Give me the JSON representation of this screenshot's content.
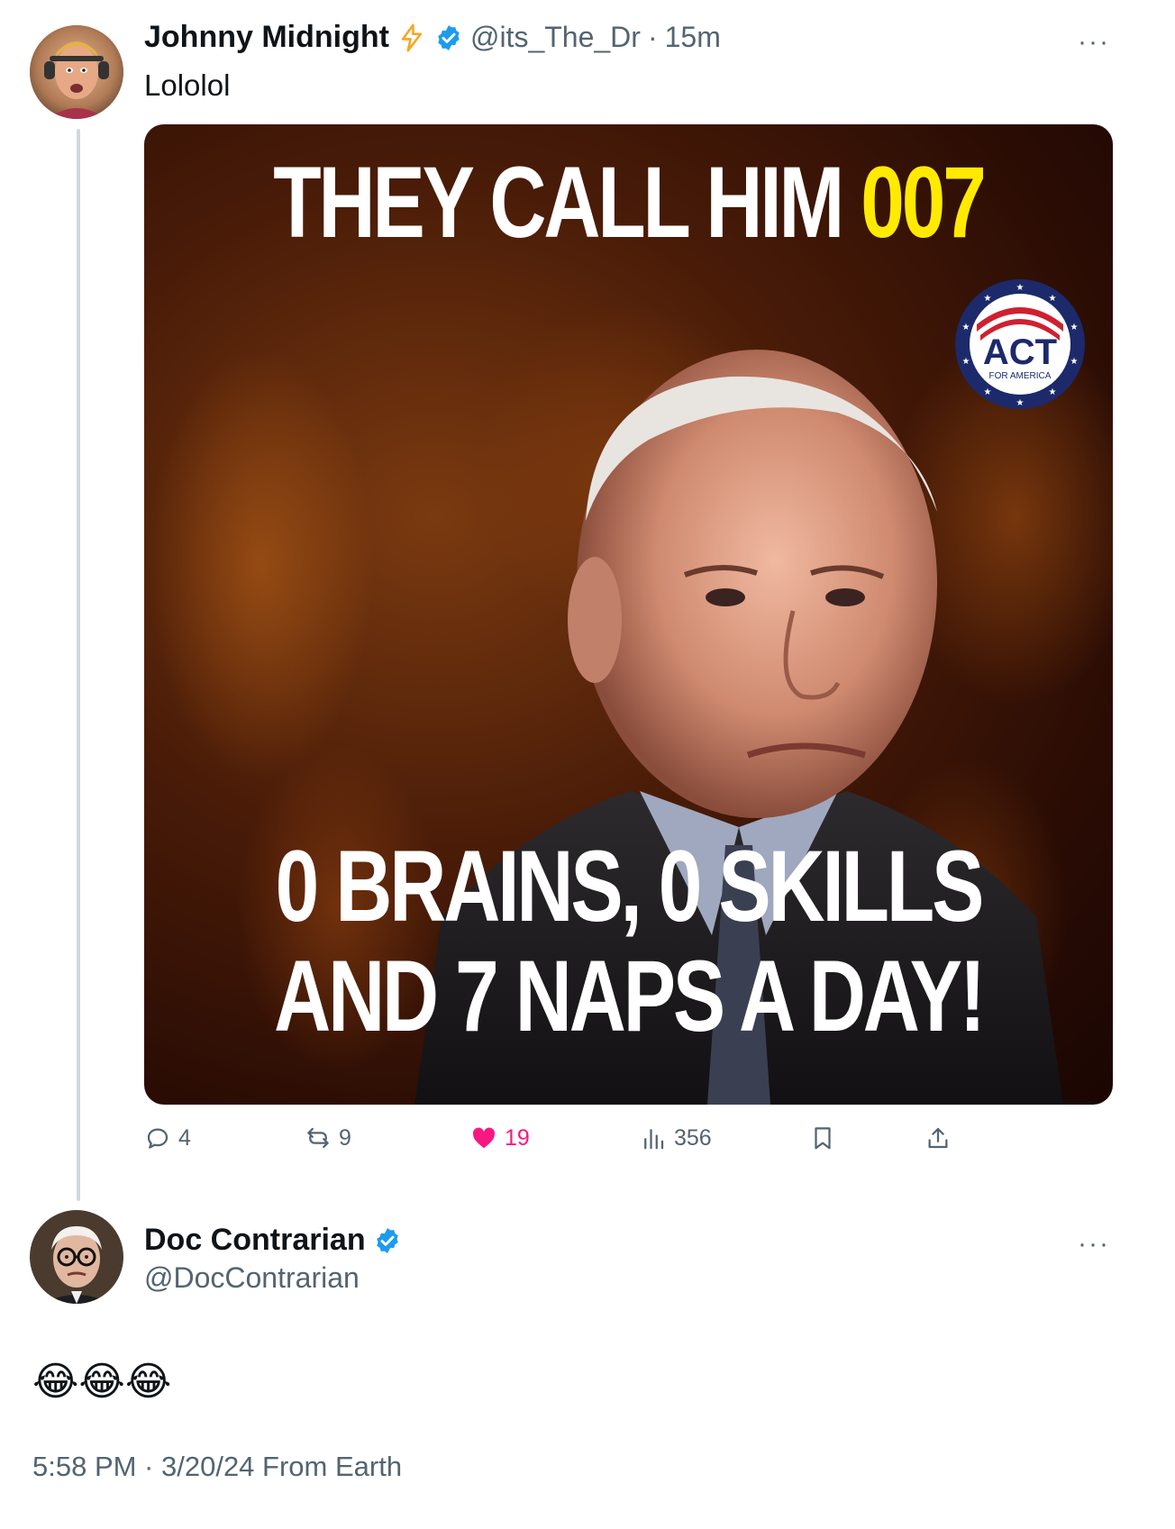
{
  "tweet": {
    "author_name": "Johnny Midnight",
    "author_handle": "@its_The_Dr",
    "time_ago": "15m",
    "text": "Lololol",
    "more_label": "···",
    "meme": {
      "top_text": "THEY CALL HIM ",
      "top_highlight": "007",
      "bottom_line1": "0 BRAINS, 0 SKILLS",
      "bottom_line2": "AND 7 NAPS A DAY!",
      "seal_main": "ACT",
      "seal_sub": "FOR AMERICA"
    },
    "actions": {
      "replies": "4",
      "reposts": "9",
      "likes": "19",
      "views": "356"
    },
    "colors": {
      "verified": "#1d9bf0",
      "lightning": "#f5a623",
      "like": "#f91880",
      "meme_highlight": "#ffea00"
    }
  },
  "reply": {
    "author_name": "Doc Contrarian",
    "author_handle": "@DocContrarian",
    "text": "😂😂😂",
    "more_label": "···",
    "timestamp": "5:58 PM · 3/20/24 From Earth"
  }
}
